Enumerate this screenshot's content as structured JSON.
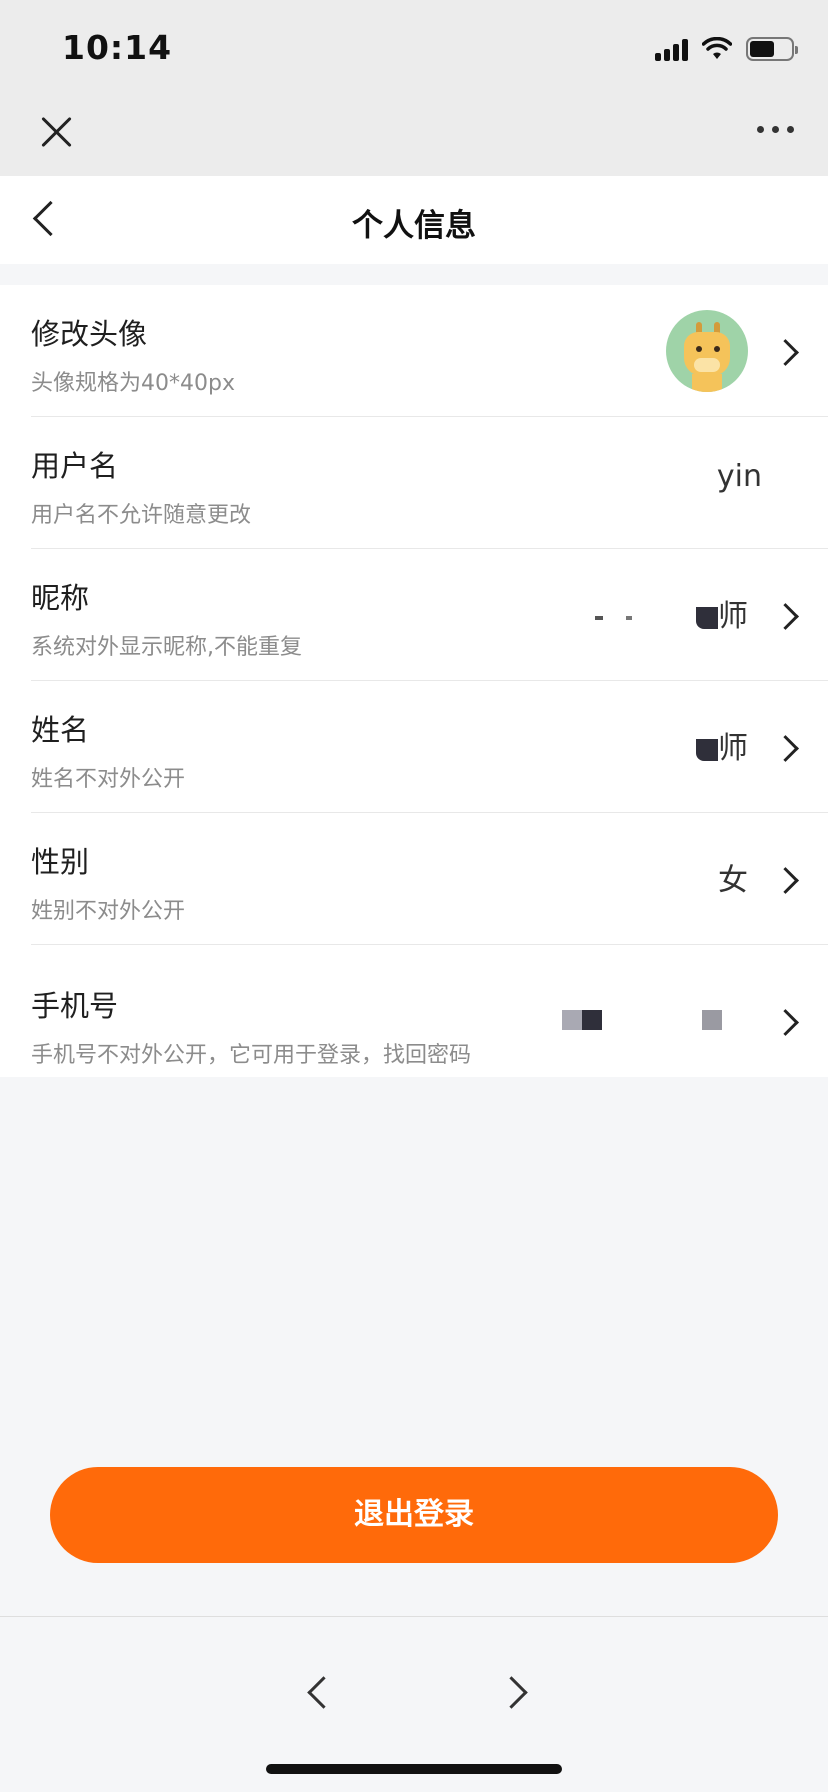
{
  "status_bar": {
    "time": "10:14",
    "battery_level": 0.6
  },
  "top_bar": {
    "close_icon": "close-icon",
    "more_icon": "more-dots-icon"
  },
  "header": {
    "back_icon": "chevron-left-icon",
    "title": "个人信息"
  },
  "rows": [
    {
      "title": "修改头像",
      "desc": "头像规格为40*40px",
      "value": "",
      "has_avatar": true,
      "has_chevron": true
    },
    {
      "title": "用户名",
      "desc": "用户名不允许随意更改",
      "value": "yin",
      "has_chevron": false
    },
    {
      "title": "昵称",
      "desc": "系统对外显示昵称,不能重复",
      "value": "师",
      "has_chevron": true
    },
    {
      "title": "姓名",
      "desc": "姓名不对外公开",
      "value": "师",
      "has_chevron": true
    },
    {
      "title": "性别",
      "desc": "姓别不对外公开",
      "value": "女",
      "has_chevron": true
    },
    {
      "title": "手机号",
      "desc": "手机号不对外公开，它可用于登录，找回密码",
      "value": "",
      "has_chevron": true
    }
  ],
  "logout": {
    "label": "退出登录",
    "color": "#ff6a0a"
  },
  "bottom_nav": {
    "prev_icon": "chevron-left-icon",
    "next_icon": "chevron-right-icon"
  }
}
